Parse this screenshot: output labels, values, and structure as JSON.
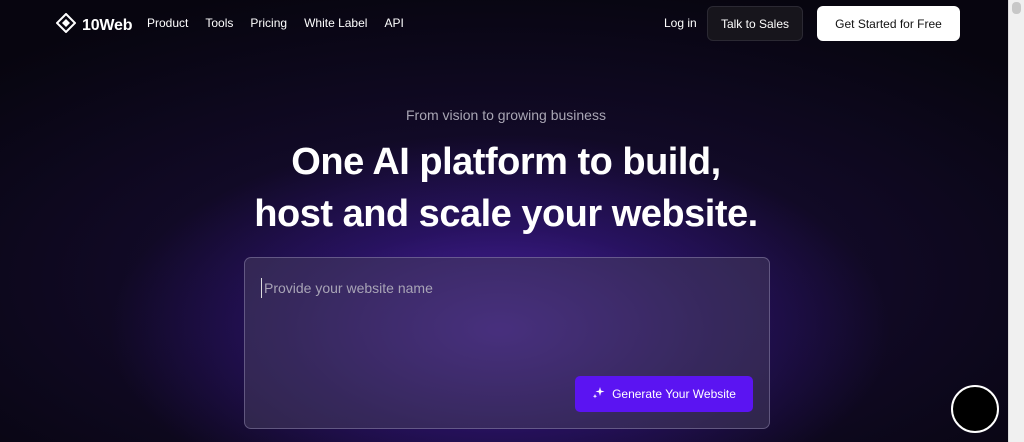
{
  "nav": {
    "logo_text": "10Web",
    "links": [
      "Product",
      "Tools",
      "Pricing",
      "White Label",
      "API"
    ],
    "login": "Log in",
    "talk_to_sales": "Talk to Sales",
    "get_started": "Get Started for Free"
  },
  "hero": {
    "eyebrow": "From vision to growing business",
    "headline_line1": "One AI platform to build,",
    "headline_line2": "host and scale your website."
  },
  "prompt": {
    "placeholder": "Provide your website name",
    "generate_button": "Generate Your Website"
  },
  "colors": {
    "accent": "#5b14f2",
    "background": "#07050f"
  },
  "icons": {
    "logo": "10web-logo-icon",
    "generate": "sparkles-icon",
    "chat": "chat-launcher-icon"
  }
}
